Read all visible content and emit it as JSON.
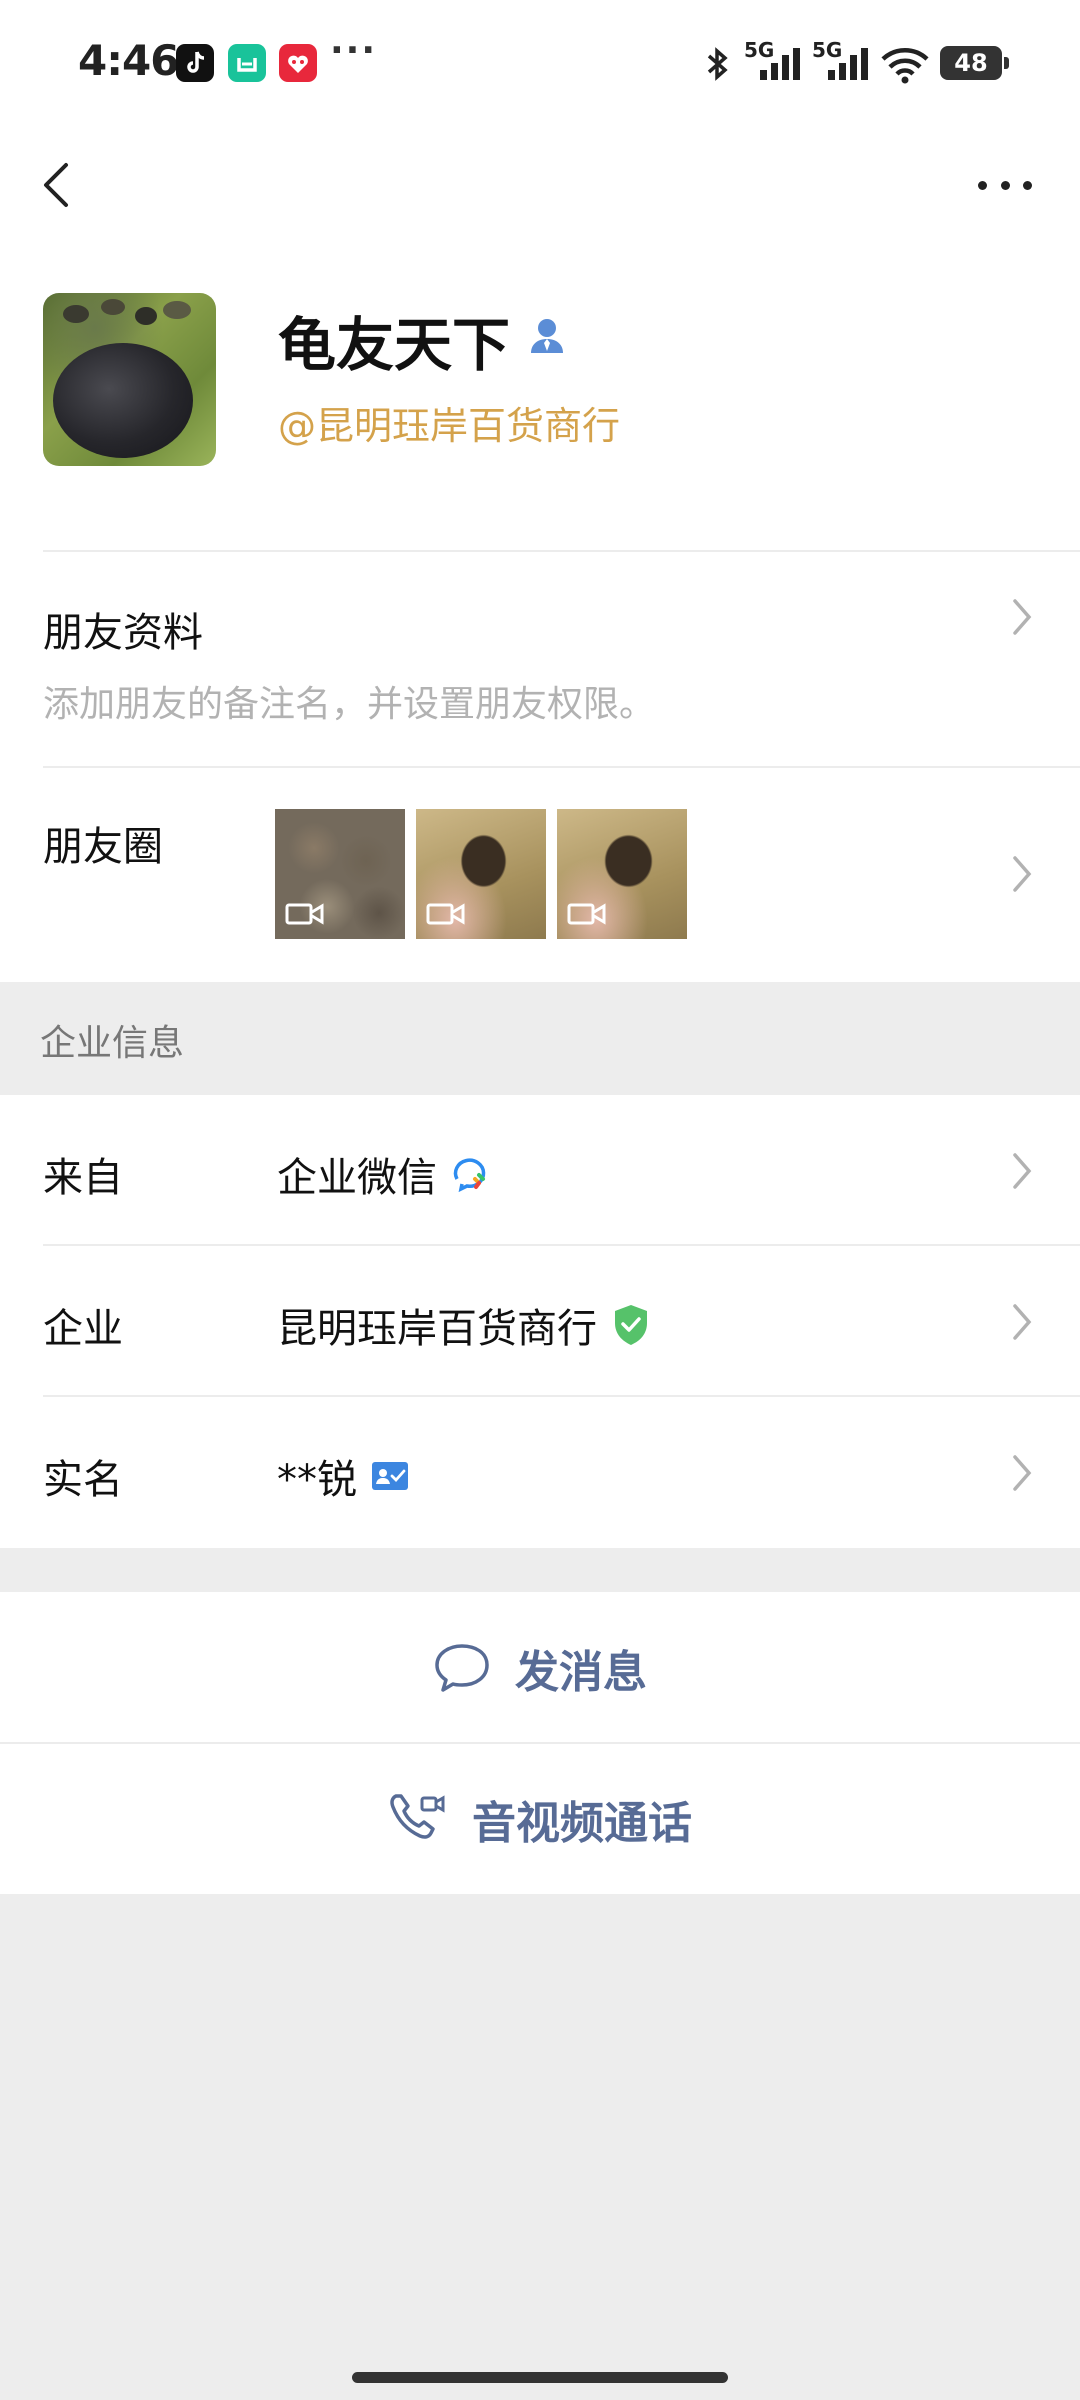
{
  "status_bar": {
    "time": "4:46",
    "dots": "···",
    "network_1": "5G",
    "network_2": "5G",
    "battery": "48",
    "icons": [
      "tiktok-icon",
      "mi-home-icon",
      "heart-app-icon",
      "bluetooth-icon",
      "signal-icon",
      "wifi-icon",
      "battery-icon"
    ]
  },
  "nav": {
    "back_icon": "chevron-left-icon",
    "more_icon": "more-dots-icon"
  },
  "profile": {
    "nickname": "龟友天下",
    "org_tag": "@昆明珏岸百货商行",
    "tag_color": "#d4a24b"
  },
  "friend_profile": {
    "title": "朋友资料",
    "subtitle": "添加朋友的备注名，并设置朋友权限。"
  },
  "moments": {
    "title": "朋友圈",
    "thumbnails": [
      {
        "type": "video",
        "icon": "video-camera-icon"
      },
      {
        "type": "video",
        "icon": "video-camera-icon"
      },
      {
        "type": "video",
        "icon": "video-camera-icon"
      }
    ]
  },
  "enterprise": {
    "section_title": "企业信息",
    "rows": [
      {
        "label": "来自",
        "value": "企业微信",
        "icon": "wecom-icon"
      },
      {
        "label": "企业",
        "value": "昆明珏岸百货商行",
        "icon": "verified-shield-icon"
      },
      {
        "label": "实名",
        "value": "**锐",
        "icon": "id-card-icon"
      }
    ]
  },
  "actions": {
    "message": "发消息",
    "call": "音视频通话",
    "accent_color": "#576b95"
  }
}
